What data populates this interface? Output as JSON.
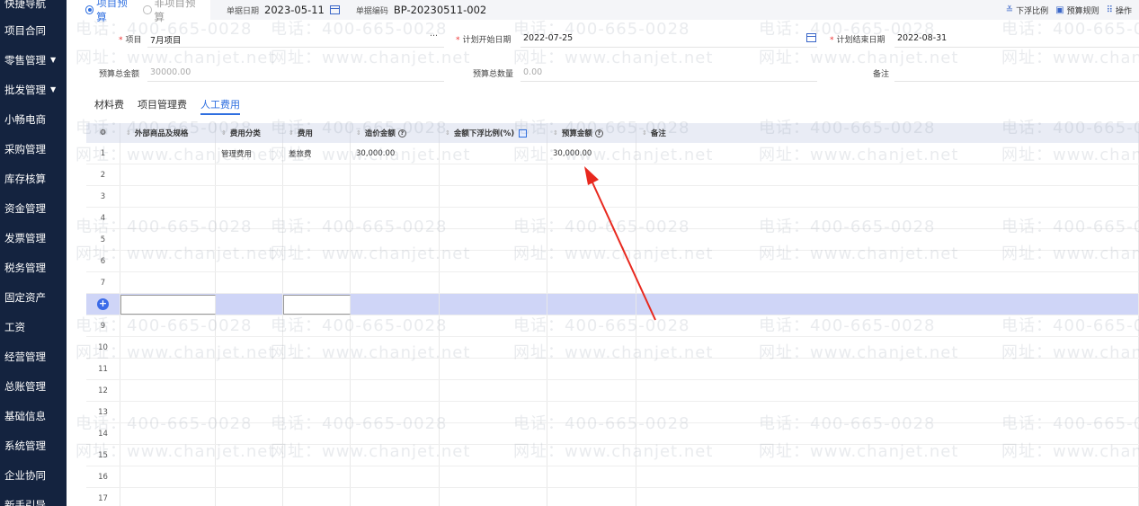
{
  "sidebar": {
    "items": [
      {
        "label": "快捷导航",
        "caret": ""
      },
      {
        "label": "项目合同",
        "caret": ""
      },
      {
        "label": "零售管理",
        "caret": "▼"
      },
      {
        "label": "批发管理",
        "caret": "▼"
      },
      {
        "label": "小畅电商",
        "caret": ""
      },
      {
        "label": "采购管理",
        "caret": ""
      },
      {
        "label": "库存核算",
        "caret": ""
      },
      {
        "label": "资金管理",
        "caret": ""
      },
      {
        "label": "发票管理",
        "caret": ""
      },
      {
        "label": "税务管理",
        "caret": ""
      },
      {
        "label": "固定资产",
        "caret": ""
      },
      {
        "label": "工资",
        "caret": ""
      },
      {
        "label": "经营管理",
        "caret": ""
      },
      {
        "label": "总账管理",
        "caret": ""
      },
      {
        "label": "基础信息",
        "caret": ""
      },
      {
        "label": "系统管理",
        "caret": ""
      },
      {
        "label": "企业协同",
        "caret": ""
      },
      {
        "label": "新手引导",
        "caret": ""
      }
    ]
  },
  "topbar": {
    "radio_project": "项目预算",
    "radio_non_project": "非项目预算",
    "date_label": "单据日期",
    "date_value": "2023-05-11",
    "code_label": "单据编码",
    "code_value": "BP-20230511-002",
    "actions": [
      {
        "icon": "float-ratio-icon",
        "glyph": "≚",
        "label": "下浮比例"
      },
      {
        "icon": "budget-rule-icon",
        "glyph": "▣",
        "label": "预算规则"
      },
      {
        "icon": "operate-icon",
        "glyph": "⠿",
        "label": "操作"
      }
    ]
  },
  "form": {
    "project_label": "项目",
    "project_value": "7月项目",
    "project_more": "···",
    "start_label": "计划开始日期",
    "start_value": "2022-07-25",
    "end_label": "计划结束日期",
    "end_value": "2022-08-31",
    "total_amount_label": "预算总金额",
    "total_amount_value": "30000.00",
    "total_qty_label": "预算总数量",
    "total_qty_value": "0.00",
    "remark_label": "备注"
  },
  "tabs": [
    {
      "label": "材料费",
      "active": false
    },
    {
      "label": "项目管理费",
      "active": false
    },
    {
      "label": "人工费用",
      "active": true
    }
  ],
  "grid": {
    "settings_glyph": "⚙",
    "columns": [
      "外部商品及规格",
      "费用分类",
      "费用",
      "造价金额",
      "金额下浮比例(%)",
      "预算金额",
      "备注"
    ],
    "rows": [
      {
        "no": "1",
        "cells": [
          "",
          "管理费用",
          "差旅费",
          "30,000.00",
          "",
          "30,000.00",
          ""
        ]
      },
      {
        "no": "2",
        "cells": [
          "",
          "",
          "",
          "",
          "",
          "",
          ""
        ]
      },
      {
        "no": "3",
        "cells": [
          "",
          "",
          "",
          "",
          "",
          "",
          ""
        ]
      },
      {
        "no": "4",
        "cells": [
          "",
          "",
          "",
          "",
          "",
          "",
          ""
        ]
      },
      {
        "no": "5",
        "cells": [
          "",
          "",
          "",
          "",
          "",
          "",
          ""
        ]
      },
      {
        "no": "6",
        "cells": [
          "",
          "",
          "",
          "",
          "",
          "",
          ""
        ]
      },
      {
        "no": "7",
        "cells": [
          "",
          "",
          "",
          "",
          "",
          "",
          ""
        ]
      },
      {
        "no": "+",
        "cells": [
          "",
          "",
          "",
          "",
          "",
          "",
          ""
        ]
      },
      {
        "no": "9",
        "cells": [
          "",
          "",
          "",
          "",
          "",
          "",
          ""
        ]
      },
      {
        "no": "10",
        "cells": [
          "",
          "",
          "",
          "",
          "",
          "",
          ""
        ]
      },
      {
        "no": "11",
        "cells": [
          "",
          "",
          "",
          "",
          "",
          "",
          ""
        ]
      },
      {
        "no": "12",
        "cells": [
          "",
          "",
          "",
          "",
          "",
          "",
          ""
        ]
      },
      {
        "no": "13",
        "cells": [
          "",
          "",
          "",
          "",
          "",
          "",
          ""
        ]
      },
      {
        "no": "14",
        "cells": [
          "",
          "",
          "",
          "",
          "",
          "",
          ""
        ]
      },
      {
        "no": "15",
        "cells": [
          "",
          "",
          "",
          "",
          "",
          "",
          ""
        ]
      },
      {
        "no": "16",
        "cells": [
          "",
          "",
          "",
          "",
          "",
          "",
          ""
        ]
      },
      {
        "no": "17",
        "cells": [
          "",
          "",
          "",
          "",
          "",
          "",
          ""
        ]
      }
    ]
  },
  "watermark": {
    "phone": "电话：400-665-0028",
    "site": "网址：www.chanjet.net"
  },
  "colors": {
    "sidebar_bg": "#14233f",
    "accent": "#2f6fe0",
    "active_row": "#cfd5f7",
    "arrow": "#e8281e"
  }
}
